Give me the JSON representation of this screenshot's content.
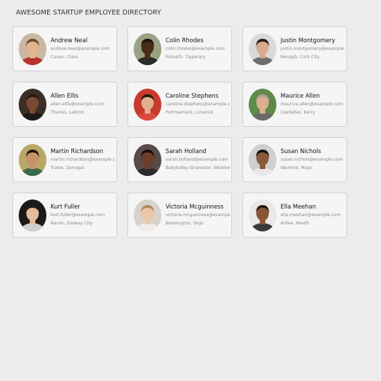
{
  "header": {
    "title": "AWESOME STARTUP EMPLOYEE DIRECTORY"
  },
  "employees": [
    {
      "name": "Andrew Neal",
      "email": "andrew.neal@example.com",
      "location": "Cavan, Clare",
      "avatar": {
        "bg": "#c9b8a3",
        "skin": "#e3b48f",
        "hair": "#6b4a2c",
        "shirt": "#b8322e"
      }
    },
    {
      "name": "Colin Rhodes",
      "email": "colin.rhodes@example.com",
      "location": "Ratoath, Tipperary",
      "avatar": {
        "bg": "#9aa283",
        "skin": "#4a2c1a",
        "hair": "#1e130c",
        "shirt": "#2b2b2b"
      }
    },
    {
      "name": "Justin Montgomery",
      "email": "justin.montgomery@example.com",
      "location": "Nenagh, Cork City",
      "avatar": {
        "bg": "#d9d9d9",
        "skin": "#d8a98a",
        "hair": "#2a1d14",
        "shirt": "#6e6e6e"
      }
    },
    {
      "name": "Allen Ellis",
      "email": "allen.ellis@example.com",
      "location": "Thurles, Leitrim",
      "avatar": {
        "bg": "#3a2e26",
        "skin": "#7a4a30",
        "hair": "#2a1a10",
        "shirt": "#1a1a1a"
      }
    },
    {
      "name": "Caroline Stephens",
      "email": "caroline.stephens@example.com",
      "location": "Portmarnock, Limerick",
      "avatar": {
        "bg": "#c93a2e",
        "skin": "#e2b08e",
        "hair": "#2a1a10",
        "shirt": "#d94a3a"
      }
    },
    {
      "name": "Maurice Allen",
      "email": "maurice.allen@example.com",
      "location": "Castlebar, Kerry",
      "avatar": {
        "bg": "#5e8a4a",
        "skin": "#dcae90",
        "hair": "#b0a090",
        "shirt": "#6a6a6a"
      }
    },
    {
      "name": "Martin Richardson",
      "email": "martin.richardson@example.com",
      "location": "Tralee, Donegal",
      "avatar": {
        "bg": "#b8a868",
        "skin": "#c8906a",
        "hair": "#1e130c",
        "shirt": "#3a6a4a"
      }
    },
    {
      "name": "Sarah Holland",
      "email": "sarah.holland@example.com",
      "location": "Ballybofey-Stranorlar, Wicklow",
      "avatar": {
        "bg": "#5a4a4a",
        "skin": "#6e3e28",
        "hair": "#1a100a",
        "shirt": "#2a2a2a"
      }
    },
    {
      "name": "Susan Nichols",
      "email": "susan.nichols@example.com",
      "location": "Wexford, Mayo",
      "avatar": {
        "bg": "#cfcfcf",
        "skin": "#8a5a3a",
        "hair": "#1a100a",
        "shirt": "#e8e8e8"
      }
    },
    {
      "name": "Kurt Fuller",
      "email": "kurt.fuller@example.com",
      "location": "Navan, Galway City",
      "avatar": {
        "bg": "#1a1a1a",
        "skin": "#e4bc9c",
        "hair": "#2a1d14",
        "shirt": "#cfcfcf"
      }
    },
    {
      "name": "Victoria Mcguinness",
      "email": "victoria.mcguinness@example.com",
      "location": "Blessington, Sligo",
      "avatar": {
        "bg": "#d8d2cc",
        "skin": "#ecc8aa",
        "hair": "#b08a5a",
        "shirt": "#f0ece8"
      }
    },
    {
      "name": "Ella Meehan",
      "email": "ella.meehan@example.com",
      "location": "Ardee, Meath",
      "avatar": {
        "bg": "#e8e8e8",
        "skin": "#8a5436",
        "hair": "#2a1a10",
        "shirt": "#3a3a3a"
      }
    }
  ]
}
